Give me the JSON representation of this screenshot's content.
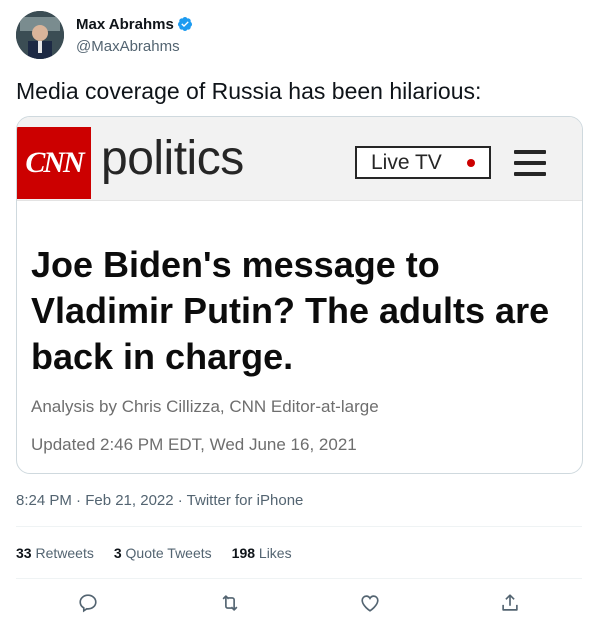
{
  "author": {
    "name": "Max Abrahms",
    "handle": "@MaxAbrahms",
    "verified_icon": "verified-badge-icon"
  },
  "tweet": {
    "text": "Media coverage of Russia has been hilarious:",
    "meta": "8:24 PM · Feb 21, 2022 · Twitter for iPhone"
  },
  "card": {
    "logo": "CNN",
    "section": "politics",
    "live_tv": "Live TV",
    "headline": "Joe Biden's message to Vladimir Putin? The adults are back in charge.",
    "byline": "Analysis by Chris Cillizza, CNN Editor-at-large",
    "updated": "Updated 2:46 PM EDT, Wed June 16, 2021",
    "colors": {
      "brand_red": "#cc0000",
      "header_bg": "#f2f2f2"
    }
  },
  "stats": {
    "retweets_count": "33",
    "retweets_label": "Retweets",
    "quotes_count": "3",
    "quotes_label": "Quote Tweets",
    "likes_count": "198",
    "likes_label": "Likes"
  },
  "actions": [
    "reply-icon",
    "retweet-icon",
    "like-icon",
    "share-icon"
  ]
}
